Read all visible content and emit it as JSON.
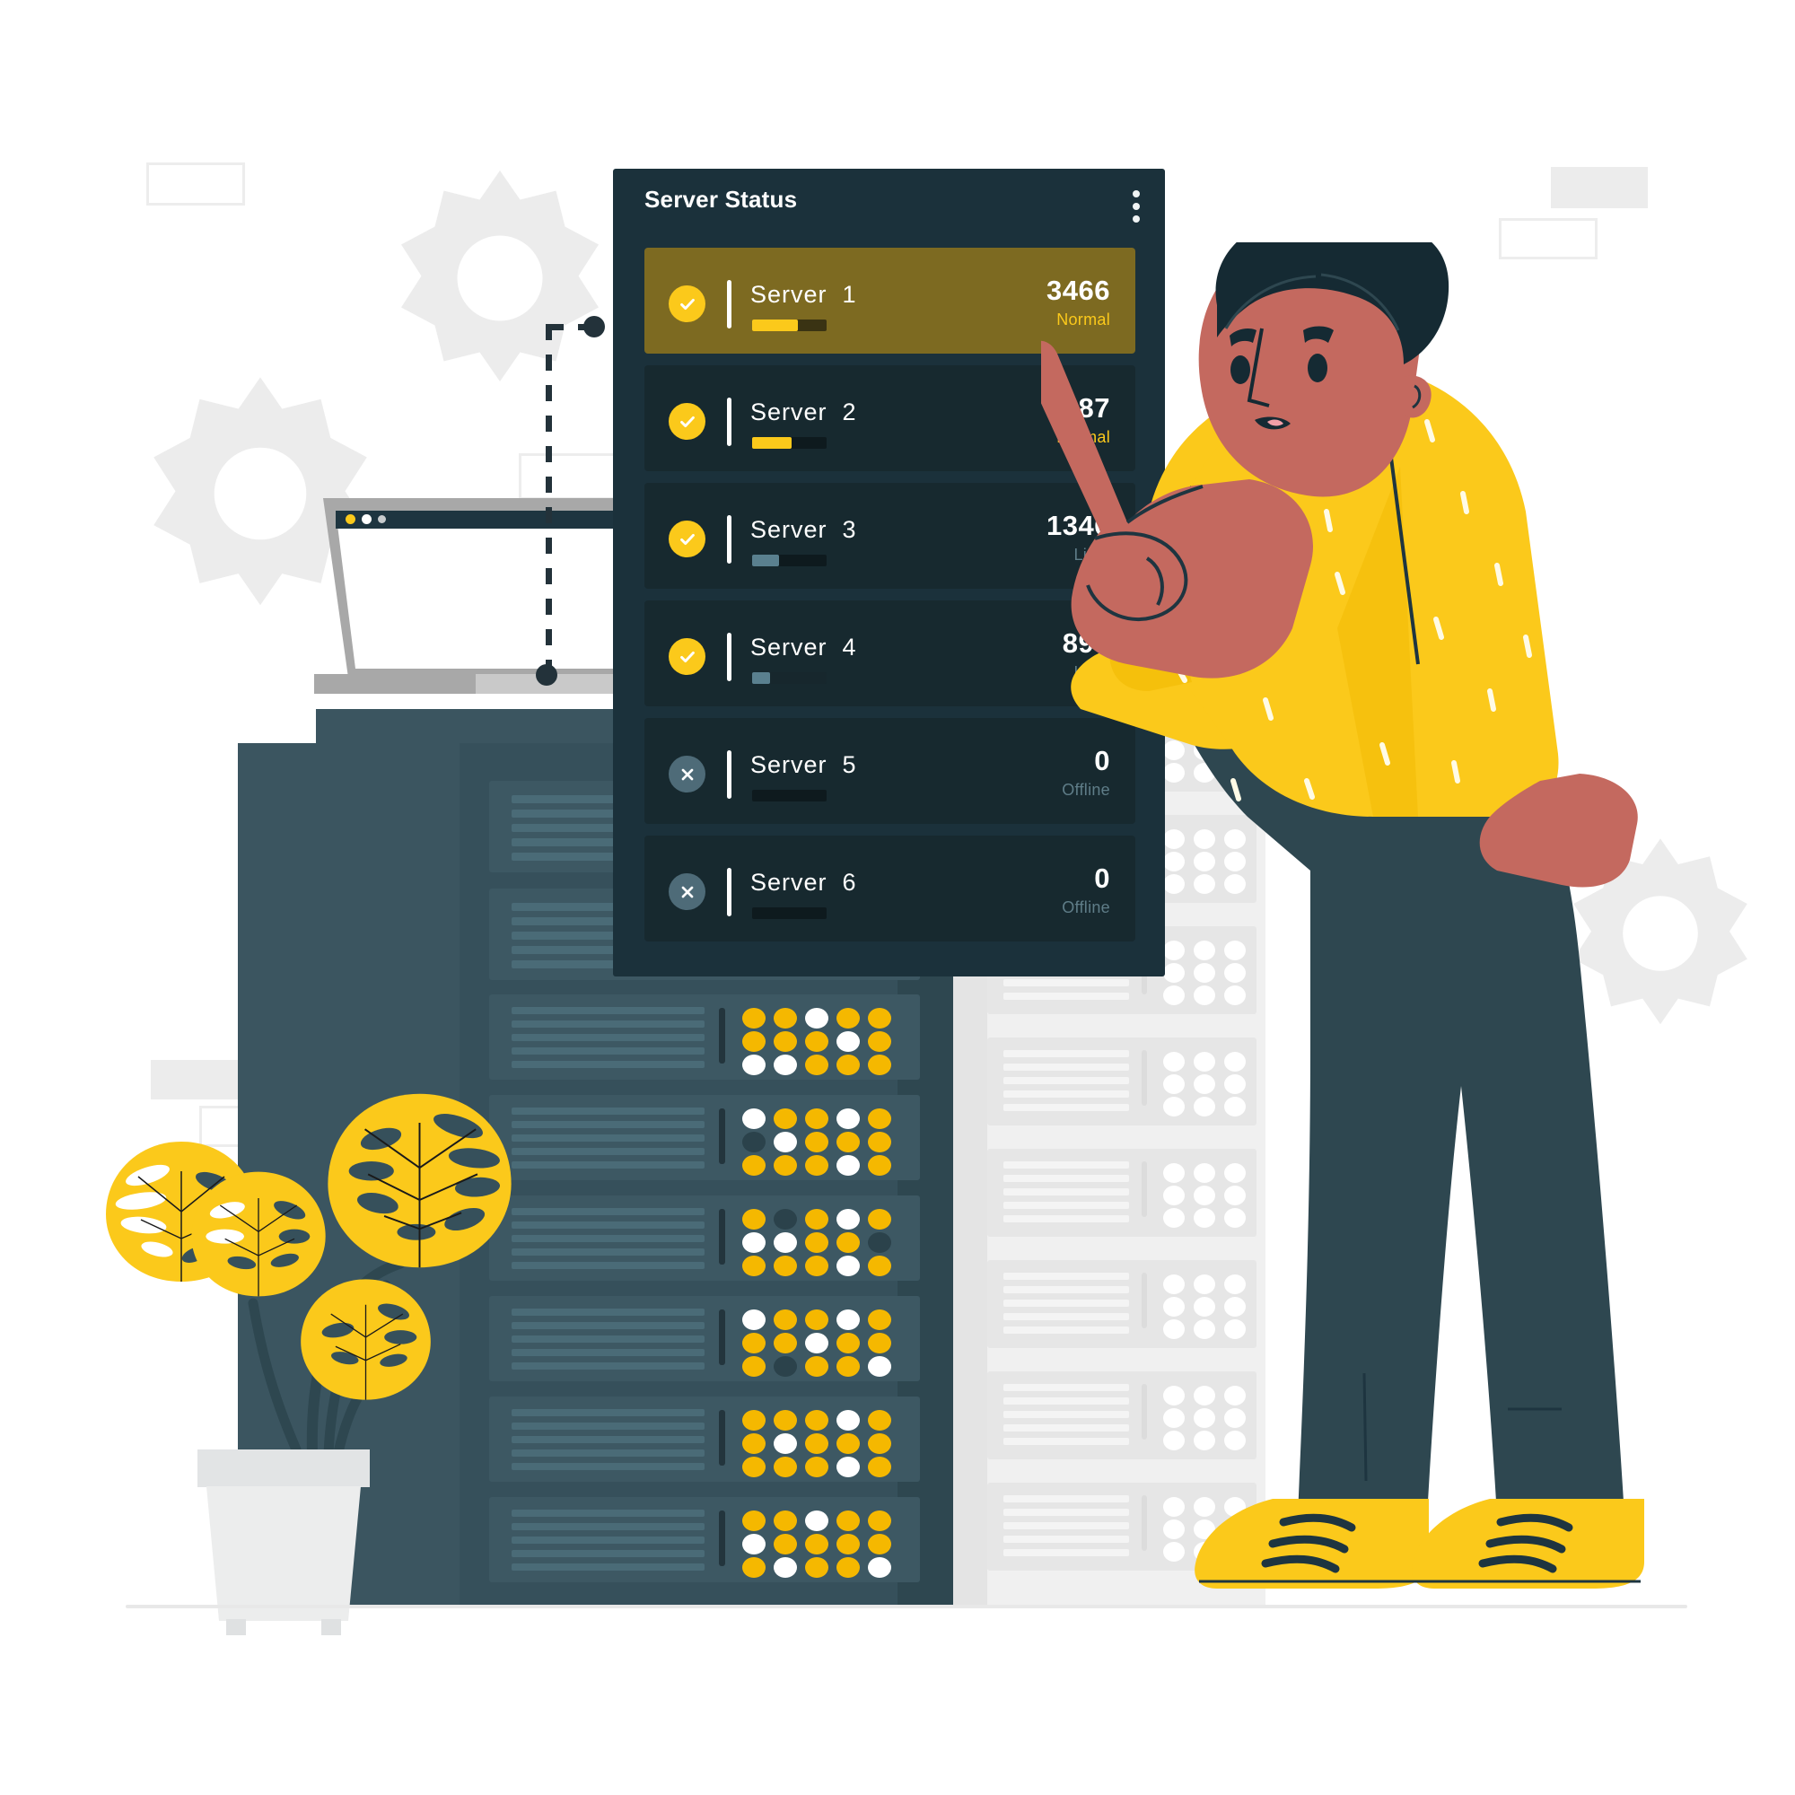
{
  "panel": {
    "title": "Server Status",
    "menu_icon": "kebab-menu-icon",
    "rows": [
      {
        "name": "Server",
        "number": "1",
        "value": "3466",
        "state": "Normal",
        "status_icon": "check-icon",
        "selected": true,
        "bar_percent": 62,
        "bar_color": "#fbc91b",
        "track_color": "#3a3313",
        "state_color": "#fbc91b"
      },
      {
        "name": "Server",
        "number": "2",
        "value": "2487",
        "state": "Normal",
        "status_icon": "check-icon",
        "selected": false,
        "bar_percent": 53,
        "bar_color": "#fbc91b",
        "track_color": "#0e1a1e",
        "state_color": "#fbc91b"
      },
      {
        "name": "Server",
        "number": "3",
        "value": "1346",
        "state": "Light",
        "status_icon": "check-icon",
        "selected": false,
        "bar_percent": 36,
        "bar_color": "#5a808f",
        "track_color": "#0e1a1e",
        "state_color": "#5f7d88"
      },
      {
        "name": "Server",
        "number": "4",
        "value": "897",
        "state": "Light",
        "status_icon": "check-icon",
        "selected": false,
        "bar_percent": 24,
        "bar_color": "#5a808f",
        "track_color": "#17272d",
        "state_color": "#5f7d88"
      },
      {
        "name": "Server",
        "number": "5",
        "value": "0",
        "state": "Offline",
        "status_icon": "cross-icon",
        "selected": false,
        "bar_percent": 0,
        "bar_color": "#0e1a1e",
        "track_color": "#0e1a1e",
        "state_color": "#5f7d88"
      },
      {
        "name": "Server",
        "number": "6",
        "value": "0",
        "state": "Offline",
        "status_icon": "cross-icon",
        "selected": false,
        "bar_percent": 0,
        "bar_color": "#0e1a1e",
        "track_color": "#0e1a1e",
        "state_color": "#5f7d88"
      }
    ]
  },
  "scene": {
    "character": "person-pointing-at-panel",
    "plant": "monstera-plant-in-pot",
    "laptop": "open-laptop",
    "rack_dark": "dark-server-rack",
    "rack_light": "light-background-server-rack",
    "gears": "background-gear-icons",
    "connector": "dashed-connector-line"
  },
  "colors": {
    "accent_yellow": "#fbc91b",
    "panel_bg": "#1b313b",
    "row_bg": "#17292f",
    "row_active_bg": "#7d6a21",
    "rack_dark": "#36505b",
    "rack_light": "#f0f0f0",
    "skin": "#c4695f",
    "hair": "#152a33",
    "pants": "#2e4750",
    "shirt": "#fbc91b",
    "background": "#ffffff"
  }
}
